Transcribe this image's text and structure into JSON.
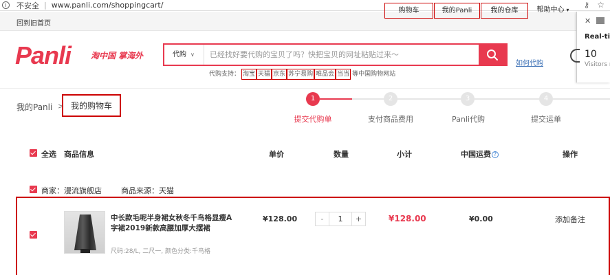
{
  "browser": {
    "insecure_label": "不安全",
    "url": "www.panli.com/shoppingcart/"
  },
  "topbar": {
    "home_link": "回到旧首页",
    "links": [
      "购物车",
      "我的Panli",
      "我的仓库"
    ],
    "help": "帮助中心"
  },
  "popup": {
    "title": "Real-tim",
    "count": "10",
    "visitors": "Visitors ri"
  },
  "header": {
    "logo": "Panli",
    "slogan": "淘中国 掌海外",
    "search_category": "代购",
    "search_placeholder": "已经找好要代购的宝贝了吗？快把宝贝的网址粘贴过来～",
    "how_to_link": "如何代购",
    "support_label": "代购支持：",
    "support_sites": [
      "淘宝",
      "天猫",
      "京东",
      "苏宁易购",
      "唯品会",
      "当当"
    ],
    "support_tail": "等中国购物网站"
  },
  "breadcrumb": {
    "root": "我的Panli",
    "separator": ">",
    "current": "我的购物车"
  },
  "steps": [
    {
      "num": "1",
      "label": "提交代购单",
      "active": true
    },
    {
      "num": "2",
      "label": "支付商品费用",
      "active": false
    },
    {
      "num": "3",
      "label": "Panli代购",
      "active": false
    },
    {
      "num": "4",
      "label": "提交运单",
      "active": false
    }
  ],
  "table": {
    "select_all": "全选",
    "headers": {
      "info": "商品信息",
      "price": "单价",
      "qty": "数量",
      "subtotal": "小计",
      "shipping": "中国运费",
      "action": "操作"
    }
  },
  "shop": {
    "name": "商家：漫流旗舰店",
    "source": "商品来源：天猫"
  },
  "item": {
    "title": "中长款毛呢半身裙女秋冬千鸟格显瘦A字裙2019新款高腰加厚大摆裙",
    "spec": "尺码:28/L, 二尺一, 颜色分类:千鸟格",
    "price": "¥128.00",
    "qty": "1",
    "qty_minus": "-",
    "qty_plus": "+",
    "subtotal": "¥128.00",
    "shipping": "¥0.00",
    "action": "添加备注"
  },
  "colors": {
    "brand": "#e8394f",
    "annotation_red": "#cc0000",
    "link_blue": "#3a6fb5"
  }
}
